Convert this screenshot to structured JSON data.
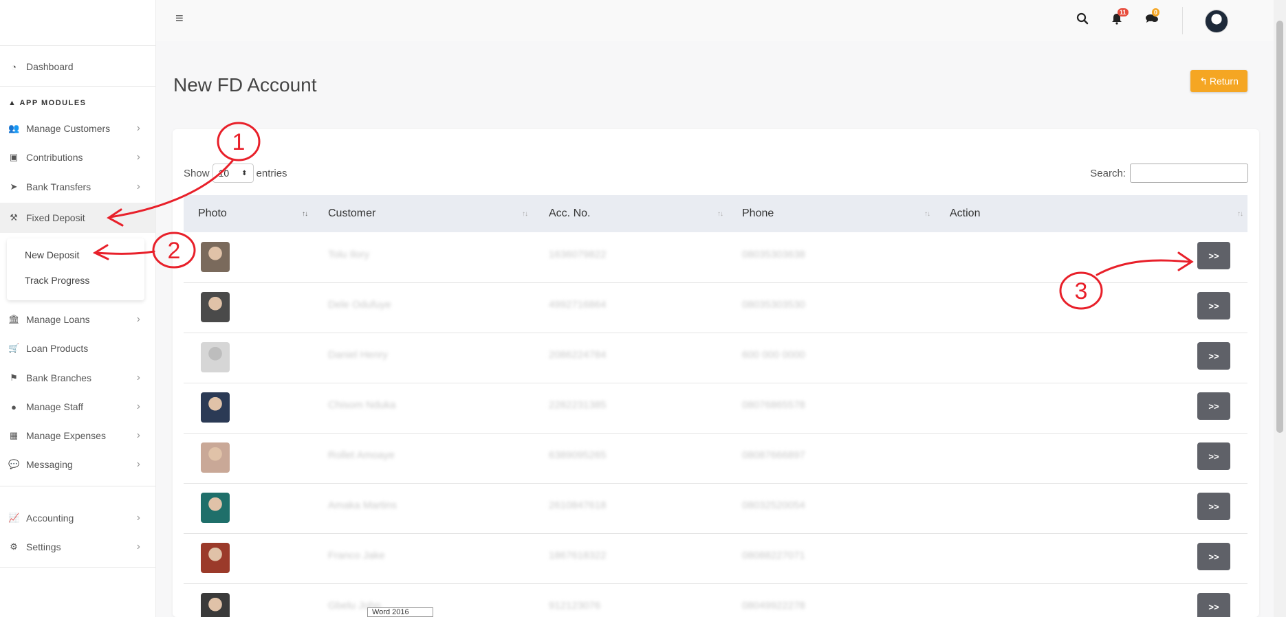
{
  "sidebar": {
    "dashboard": "Dashboard",
    "section_title": "APP MODULES",
    "items": [
      {
        "label": "Manage Customers",
        "icon": "users-icon"
      },
      {
        "label": "Contributions",
        "icon": "money-icon"
      },
      {
        "label": "Bank Transfers",
        "icon": "paper-plane-icon"
      },
      {
        "label": "Fixed Deposit",
        "icon": "gavel-icon"
      },
      {
        "label": "Manage Loans",
        "icon": "bank-icon"
      },
      {
        "label": "Loan Products",
        "icon": "cart-icon"
      },
      {
        "label": "Bank Branches",
        "icon": "flag-icon"
      },
      {
        "label": "Manage Staff",
        "icon": "user-icon"
      },
      {
        "label": "Manage Expenses",
        "icon": "calculator-icon"
      },
      {
        "label": "Messaging",
        "icon": "comments-icon"
      },
      {
        "label": "Accounting",
        "icon": "chart-icon"
      },
      {
        "label": "Settings",
        "icon": "cog-icon"
      }
    ],
    "submenu": [
      "New Deposit",
      "Track Progress"
    ]
  },
  "topbar": {
    "notification_count": "11",
    "message_count": "0"
  },
  "page": {
    "title": "New FD Account",
    "return_label": "Return"
  },
  "table": {
    "show_label": "Show",
    "entries_value": "10",
    "entries_label": "entries",
    "search_label": "Search:",
    "columns": [
      "Photo",
      "Customer",
      "Acc. No.",
      "Phone",
      "Action"
    ],
    "rows": [
      {
        "customer": "Tolu Ilory",
        "acc": "1636079822",
        "phone": "08035303638",
        "photo_color": "#7a6a5c"
      },
      {
        "customer": "Dele Odufuye",
        "acc": "4992716864",
        "phone": "08035303530",
        "photo_color": "#4a4a4a"
      },
      {
        "customer": "Daniel Henry",
        "acc": "2086224784",
        "phone": "600 000 0000",
        "photo_color": "#d6d6d6"
      },
      {
        "customer": "Chisom Nduka",
        "acc": "2282231385",
        "phone": "08076865578",
        "photo_color": "#2b3a55"
      },
      {
        "customer": "Rollet Amoaye",
        "acc": "6389095265",
        "phone": "08087666897",
        "photo_color": "#c9a897"
      },
      {
        "customer": "Amaka Martins",
        "acc": "2610847618",
        "phone": "08032520054",
        "photo_color": "#1f6f6a"
      },
      {
        "customer": "Franco Jake",
        "acc": "1867618322",
        "phone": "08088227071",
        "photo_color": "#9b3a2a"
      },
      {
        "customer": "Gbelu John",
        "acc": "912123076",
        "phone": "08049922278",
        "photo_color": "#3a3a3a"
      }
    ],
    "action_label": ">>"
  },
  "annotations": [
    "1",
    "2",
    "3"
  ],
  "tooltip": "Word 2016",
  "colors": {
    "accent_orange": "#f5a623",
    "action_button": "#5f6168",
    "annotation_red": "#e8202a",
    "header_bg": "#e9ecf2"
  }
}
